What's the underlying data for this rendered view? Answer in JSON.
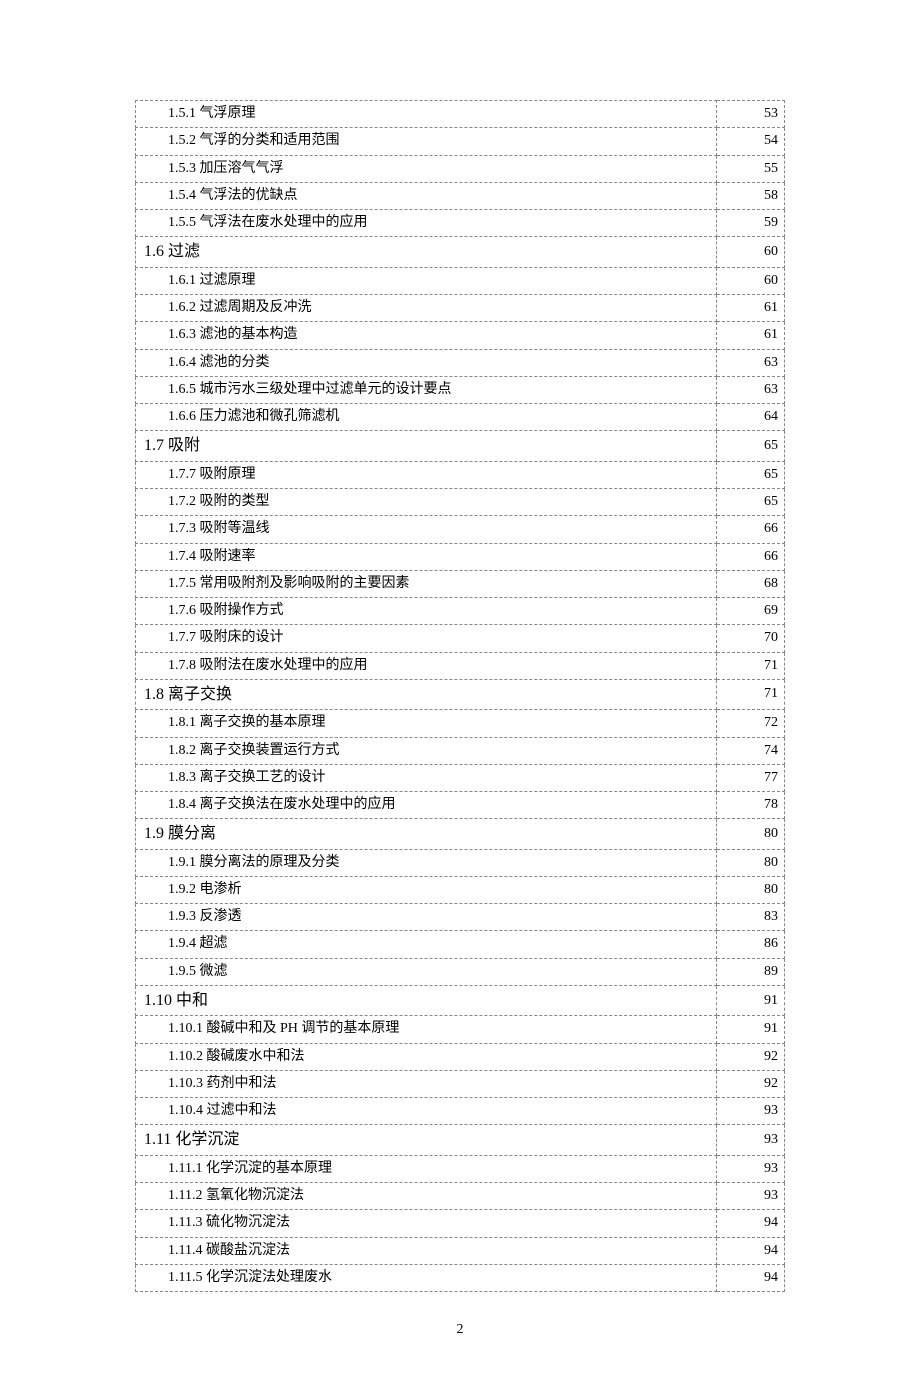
{
  "page_number": "2",
  "toc": [
    {
      "level": "sub",
      "num": "1.5.1",
      "title": "气浮原理",
      "page": "53"
    },
    {
      "level": "sub",
      "num": "1.5.2",
      "title": "气浮的分类和适用范围",
      "page": "54"
    },
    {
      "level": "sub",
      "num": "1.5.3",
      "title": "加压溶气气浮",
      "page": "55"
    },
    {
      "level": "sub",
      "num": "1.5.4",
      "title": "气浮法的优缺点",
      "page": "58"
    },
    {
      "level": "sub",
      "num": "1.5.5",
      "title": "气浮法在废水处理中的应用",
      "page": "59"
    },
    {
      "level": "section",
      "num": "1.6",
      "title": "过滤",
      "page": "60"
    },
    {
      "level": "sub",
      "num": "1.6.1",
      "title": "过滤原理",
      "page": "60"
    },
    {
      "level": "sub",
      "num": "1.6.2",
      "title": "过滤周期及反冲洗",
      "page": "61"
    },
    {
      "level": "sub",
      "num": "1.6.3",
      "title": "滤池的基本构造",
      "page": "61"
    },
    {
      "level": "sub",
      "num": "1.6.4",
      "title": "滤池的分类",
      "page": "63"
    },
    {
      "level": "sub",
      "num": "1.6.5",
      "title": "城市污水三级处理中过滤单元的设计要点",
      "page": "63"
    },
    {
      "level": "sub",
      "num": "1.6.6",
      "title": "压力滤池和微孔筛滤机",
      "page": "64"
    },
    {
      "level": "section",
      "num": "1.7",
      "title": "吸附",
      "page": "65"
    },
    {
      "level": "sub",
      "num": "1.7.7",
      "title": "吸附原理",
      "page": "65"
    },
    {
      "level": "sub",
      "num": "1.7.2",
      "title": "吸附的类型",
      "page": "65"
    },
    {
      "level": "sub",
      "num": "1.7.3",
      "title": "吸附等温线",
      "page": "66"
    },
    {
      "level": "sub",
      "num": "1.7.4",
      "title": "吸附速率",
      "page": "66"
    },
    {
      "level": "sub",
      "num": "1.7.5",
      "title": "常用吸附剂及影响吸附的主要因素",
      "page": "68"
    },
    {
      "level": "sub",
      "num": "1.7.6",
      "title": "吸附操作方式",
      "page": "69"
    },
    {
      "level": "sub",
      "num": "1.7.7",
      "title": "吸附床的设计",
      "page": "70"
    },
    {
      "level": "sub",
      "num": "1.7.8",
      "title": "吸附法在废水处理中的应用",
      "page": "71"
    },
    {
      "level": "section",
      "num": "1.8",
      "title": "离子交换",
      "page": "71"
    },
    {
      "level": "sub",
      "num": "1.8.1",
      "title": "离子交换的基本原理",
      "page": "72"
    },
    {
      "level": "sub",
      "num": "1.8.2",
      "title": "离子交换装置运行方式",
      "page": "74"
    },
    {
      "level": "sub",
      "num": "1.8.3",
      "title": "离子交换工艺的设计",
      "page": "77"
    },
    {
      "level": "sub",
      "num": "1.8.4",
      "title": "离子交换法在废水处理中的应用",
      "page": "78"
    },
    {
      "level": "section",
      "num": "1.9",
      "title": "膜分离",
      "page": "80"
    },
    {
      "level": "sub",
      "num": "1.9.1",
      "title": "膜分离法的原理及分类",
      "page": "80"
    },
    {
      "level": "sub",
      "num": "1.9.2",
      "title": "电渗析",
      "page": "80"
    },
    {
      "level": "sub",
      "num": "1.9.3",
      "title": "反渗透",
      "page": "83"
    },
    {
      "level": "sub",
      "num": "1.9.4",
      "title": "超滤",
      "page": "86"
    },
    {
      "level": "sub",
      "num": "1.9.5",
      "title": "微滤",
      "page": "89"
    },
    {
      "level": "section",
      "num": "1.10",
      "title": "中和",
      "page": "91"
    },
    {
      "level": "sub",
      "num": "1.10.1",
      "title": "酸碱中和及 PH 调节的基本原理",
      "page": "91"
    },
    {
      "level": "sub",
      "num": "1.10.2",
      "title": "酸碱废水中和法",
      "page": "92"
    },
    {
      "level": "sub",
      "num": "1.10.3",
      "title": "药剂中和法",
      "page": "92"
    },
    {
      "level": "sub",
      "num": "1.10.4",
      "title": "过滤中和法",
      "page": "93"
    },
    {
      "level": "section",
      "num": "1.11",
      "title": "化学沉淀",
      "page": "93"
    },
    {
      "level": "sub",
      "num": "1.11.1",
      "title": "化学沉淀的基本原理",
      "page": "93"
    },
    {
      "level": "sub",
      "num": "1.11.2",
      "title": "氢氧化物沉淀法",
      "page": "93"
    },
    {
      "level": "sub",
      "num": "1.11.3",
      "title": "硫化物沉淀法",
      "page": "94"
    },
    {
      "level": "sub",
      "num": "1.11.4",
      "title": "碳酸盐沉淀法",
      "page": "94"
    },
    {
      "level": "sub",
      "num": "1.11.5",
      "title": "化学沉淀法处理废水",
      "page": "94"
    }
  ]
}
